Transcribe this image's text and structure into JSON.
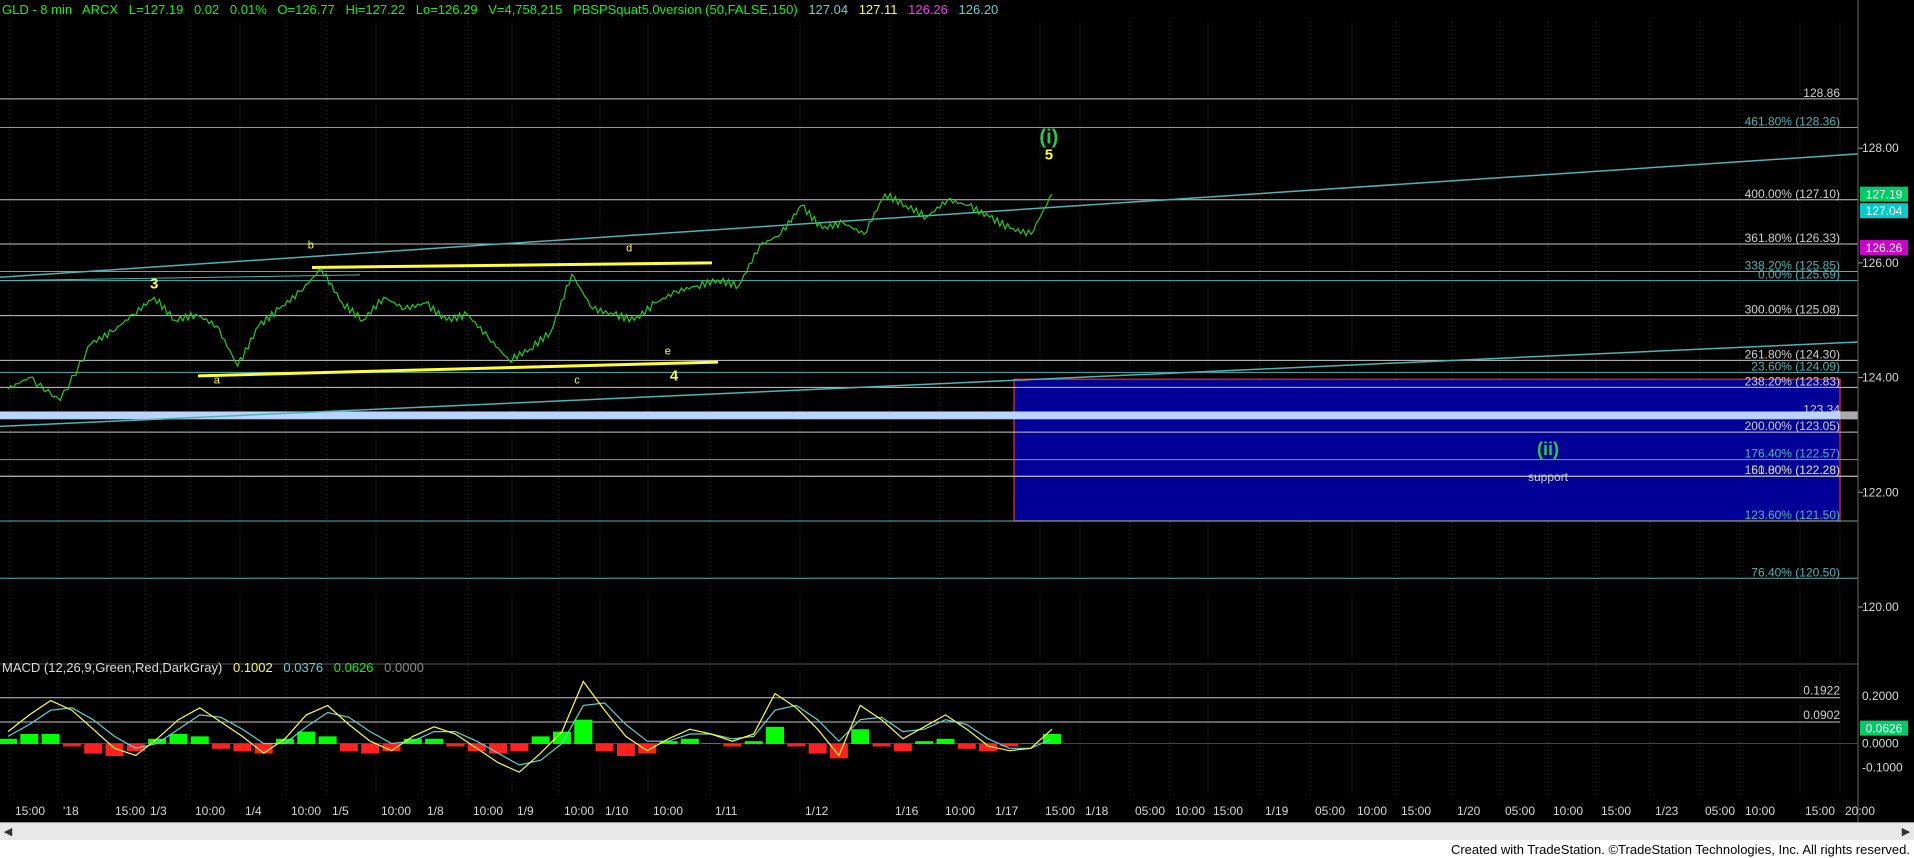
{
  "header": {
    "symbol": "GLD - 8 min",
    "exchange": "ARCX",
    "last": "L=127.19",
    "change": "0.02",
    "pct": "0.01%",
    "open": "O=126.77",
    "high": "Hi=127.22",
    "low": "Lo=126.29",
    "volume": "V=4,758,215",
    "indicator": "PBSPSquat5.0version (50,FALSE,150)",
    "ind_v1": "127.04",
    "ind_v2": "127.11",
    "ind_v3": "126.26",
    "ind_v4": "126.20"
  },
  "macd_header": {
    "name": "MACD (12,26,9,Green,Red,DarkGray)",
    "v1": "0.1002",
    "v2": "0.0376",
    "v3": "0.0626",
    "v4": "0.0000"
  },
  "footer": {
    "text": "Created with TradeStation. ©TradeStation Technologies, Inc. All rights reserved."
  },
  "colors": {
    "background": "#000000",
    "price": "#22cc22",
    "fib_teal": "#4fb3b3",
    "wave_yellow": "#ffff33",
    "wave_green": "#22cc44",
    "support_box": "#000099",
    "macd_hist_pos": "#00ff00",
    "macd_hist_neg": "#ff2020"
  },
  "chart_data": {
    "type": "line",
    "title": "GLD - 8 min",
    "ylim": [
      119.25,
      130.2
    ],
    "x_tick_labels": [
      "15:00",
      "'18",
      "15:00",
      "1/3",
      "10:00",
      "1/4",
      "10:00",
      "1/5",
      "10:00",
      "1/8",
      "10:00",
      "1/9",
      "10:00",
      "1/10",
      "10:00",
      "1/11",
      "1/12",
      "1/16",
      "10:00",
      "1/17",
      "15:00",
      "1/18",
      "05:00",
      "10:00",
      "15:00",
      "1/19",
      "05:00",
      "10:00",
      "15:00",
      "1/20",
      "05:00",
      "10:00",
      "15:00",
      "1/23",
      "05:00",
      "10:00",
      "15:00",
      "20:00"
    ],
    "y_ticks": [
      120.0,
      122.0,
      124.0,
      126.0,
      128.0
    ],
    "y_tick_labels": [
      "120.00",
      "122.00",
      "124.00",
      "126.00",
      "128.00"
    ],
    "price_series": {
      "name": "GLD",
      "x": [
        0,
        0.02,
        0.05,
        0.08,
        0.1,
        0.12,
        0.14,
        0.16,
        0.18,
        0.2,
        0.22,
        0.24,
        0.26,
        0.28,
        0.3,
        0.32,
        0.34,
        0.36,
        0.38,
        0.4,
        0.42,
        0.44,
        0.46,
        0.48,
        0.5,
        0.52,
        0.54,
        0.56,
        0.58,
        0.6,
        0.62,
        0.64,
        0.66,
        0.68,
        0.7,
        0.72,
        0.74,
        0.76,
        0.78,
        0.8,
        0.82,
        0.84,
        0.86,
        0.88,
        0.9,
        0.92,
        0.94,
        0.96,
        0.98,
        1.0
      ],
      "y": [
        123.8,
        124.0,
        123.6,
        124.6,
        124.8,
        125.1,
        125.4,
        125.0,
        125.1,
        124.9,
        124.2,
        124.9,
        125.2,
        125.5,
        125.9,
        125.3,
        125.0,
        125.4,
        125.2,
        125.3,
        125.0,
        125.1,
        124.7,
        124.3,
        124.5,
        124.8,
        125.8,
        125.2,
        125.1,
        125.0,
        125.3,
        125.5,
        125.6,
        125.7,
        125.6,
        126.3,
        126.5,
        127.0,
        126.6,
        126.7,
        126.5,
        127.2,
        127.0,
        126.8,
        127.1,
        127.0,
        126.8,
        126.6,
        126.5,
        127.2
      ]
    },
    "horizontal_levels": [
      {
        "price": 128.86,
        "label": "128.86"
      },
      {
        "price": 128.36,
        "label": "461.80% (128.36)"
      },
      {
        "price": 127.1,
        "label": "400.00% (127.10)"
      },
      {
        "price": 126.33,
        "label": "361.80% (126.33)"
      },
      {
        "price": 125.85,
        "label": "338.20% (125.85)"
      },
      {
        "price": 125.69,
        "label": "0.00% (125.69)"
      },
      {
        "price": 125.08,
        "label": "300.00% (125.08)"
      },
      {
        "price": 124.3,
        "label": "261.80% (124.30)"
      },
      {
        "price": 124.09,
        "label": "23.60% (124.09)"
      },
      {
        "price": 123.83,
        "label": "238.20% (123.83)"
      },
      {
        "price": 123.34,
        "label": "123.34"
      },
      {
        "price": 123.05,
        "label": "200.00% (123.05)"
      },
      {
        "price": 122.57,
        "label": "176.40% (122.57)"
      },
      {
        "price": 122.28,
        "label": "50.00% (122.28)"
      },
      {
        "price": 122.28,
        "label": "161.80% (122.28)"
      },
      {
        "price": 121.5,
        "label": "123.60% (121.50)"
      },
      {
        "price": 120.5,
        "label": "76.40% (120.50)"
      }
    ],
    "price_tags": [
      {
        "price": 127.19,
        "label": "127.19",
        "color": "#00cc66"
      },
      {
        "price": 127.04,
        "label": "127.04",
        "color": "#00cccc"
      },
      {
        "price": 126.26,
        "label": "126.26",
        "color": "#cc00cc"
      }
    ],
    "support_zone": {
      "top": 123.97,
      "bottom": 121.5,
      "x_start": 0.958,
      "label": "support",
      "wave_label": "(ii)"
    },
    "wave_labels": [
      {
        "text": "3",
        "x": 0.14,
        "price": 125.55
      },
      {
        "text": "a",
        "x": 0.2,
        "price": 123.9
      },
      {
        "text": "b",
        "x": 0.29,
        "price": 126.25
      },
      {
        "text": "c",
        "x": 0.545,
        "price": 123.9
      },
      {
        "text": "d",
        "x": 0.595,
        "price": 126.2
      },
      {
        "text": "e",
        "x": 0.632,
        "price": 124.4
      },
      {
        "text": "4",
        "x": 0.638,
        "price": 123.95
      },
      {
        "text": "5",
        "x": 0.997,
        "price": 127.8
      },
      {
        "text": "(i)",
        "x": 0.997,
        "price": 128.08
      }
    ],
    "macd": {
      "ylim": [
        -0.22,
        0.3
      ],
      "y_tick_labels": [
        "0.2000",
        "0.0000",
        "-0.1000"
      ],
      "y_ticks": [
        0.2,
        0.0,
        -0.1
      ],
      "levels": [
        {
          "value": 0.1922,
          "label": "0.1922"
        },
        {
          "value": 0.0902,
          "label": "0.0902"
        }
      ],
      "current_tag": {
        "value": 0.0626,
        "label": "0.0626"
      },
      "macd_line": [
        0.05,
        0.12,
        0.18,
        0.14,
        0.06,
        -0.02,
        -0.05,
        0.02,
        0.1,
        0.15,
        0.09,
        0.03,
        -0.04,
        0.02,
        0.12,
        0.16,
        0.08,
        0.01,
        -0.03,
        0.03,
        0.07,
        0.04,
        -0.02,
        -0.08,
        -0.12,
        -0.04,
        0.05,
        0.26,
        0.14,
        0.03,
        -0.03,
        0.02,
        0.06,
        0.04,
        0.01,
        0.04,
        0.21,
        0.15,
        0.06,
        -0.05,
        0.16,
        0.1,
        0.02,
        0.07,
        0.12,
        0.06,
        -0.01,
        -0.03,
        -0.02,
        0.06
      ],
      "signal_line": [
        0.03,
        0.08,
        0.14,
        0.15,
        0.1,
        0.03,
        -0.02,
        0.0,
        0.06,
        0.12,
        0.11,
        0.06,
        0.0,
        0.0,
        0.07,
        0.13,
        0.11,
        0.05,
        0.0,
        0.01,
        0.05,
        0.05,
        0.01,
        -0.04,
        -0.09,
        -0.07,
        0.0,
        0.16,
        0.17,
        0.08,
        0.01,
        0.01,
        0.04,
        0.04,
        0.02,
        0.03,
        0.14,
        0.16,
        0.1,
        0.01,
        0.1,
        0.11,
        0.05,
        0.06,
        0.1,
        0.08,
        0.02,
        -0.02,
        -0.02,
        0.02
      ],
      "histogram": [
        0.02,
        0.04,
        0.04,
        -0.01,
        -0.04,
        -0.05,
        -0.03,
        0.02,
        0.04,
        0.03,
        -0.02,
        -0.03,
        -0.04,
        0.02,
        0.05,
        0.03,
        -0.03,
        -0.04,
        -0.03,
        0.02,
        0.02,
        -0.01,
        -0.03,
        -0.04,
        -0.03,
        0.03,
        0.05,
        0.1,
        -0.03,
        -0.05,
        -0.04,
        0.01,
        0.02,
        0.0,
        -0.01,
        0.01,
        0.07,
        -0.01,
        -0.04,
        -0.06,
        0.06,
        -0.01,
        -0.03,
        0.01,
        0.02,
        -0.02,
        -0.03,
        -0.01,
        0.0,
        0.04
      ]
    }
  }
}
